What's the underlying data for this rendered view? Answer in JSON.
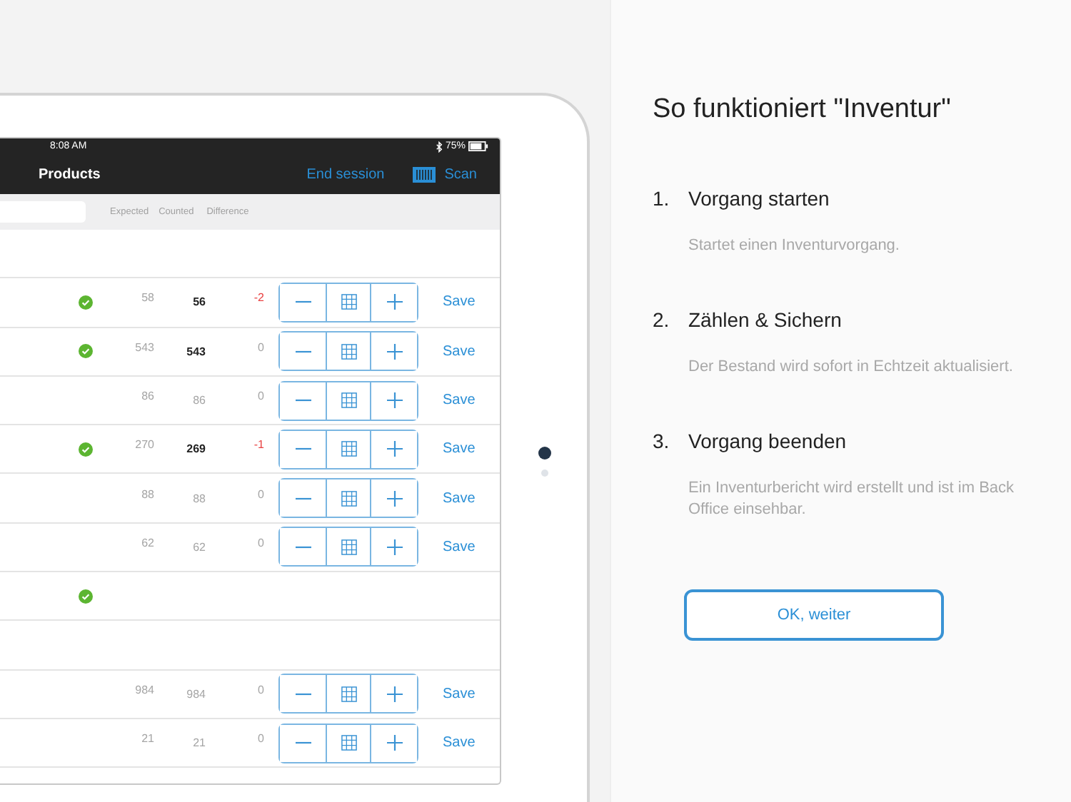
{
  "device": {
    "status_bar": {
      "time": "8:08 AM",
      "battery": "75%"
    },
    "nav_bar": {
      "title": "Products",
      "end_session": "End session",
      "scan": "Scan"
    },
    "table": {
      "columns": [
        "Expected",
        "Counted",
        "Difference"
      ],
      "rows": [
        {
          "kind": "group",
          "confirmed": false
        },
        {
          "kind": "item",
          "confirmed": true,
          "expected": "58",
          "counted": "56",
          "difference": "-2",
          "discrepancy": true,
          "save": "Save"
        },
        {
          "kind": "item",
          "confirmed": true,
          "expected": "543",
          "counted": "543",
          "difference": "0",
          "discrepancy": false,
          "save": "Save"
        },
        {
          "kind": "item",
          "confirmed": false,
          "expected": "86",
          "counted": "86",
          "difference": "0",
          "discrepancy": false,
          "save": "Save"
        },
        {
          "kind": "item",
          "confirmed": true,
          "expected": "270",
          "counted": "269",
          "difference": "-1",
          "discrepancy": true,
          "save": "Save"
        },
        {
          "kind": "item",
          "confirmed": false,
          "expected": "88",
          "counted": "88",
          "difference": "0",
          "discrepancy": false,
          "save": "Save"
        },
        {
          "kind": "item",
          "confirmed": false,
          "expected": "62",
          "counted": "62",
          "difference": "0",
          "discrepancy": false,
          "save": "Save"
        },
        {
          "kind": "group",
          "confirmed": true
        },
        {
          "kind": "group",
          "confirmed": false
        },
        {
          "kind": "item",
          "confirmed": false,
          "expected": "984",
          "counted": "984",
          "difference": "0",
          "discrepancy": false,
          "save": "Save"
        },
        {
          "kind": "item",
          "confirmed": false,
          "expected": "21",
          "counted": "21",
          "difference": "0",
          "discrepancy": false,
          "save": "Save"
        }
      ]
    }
  },
  "page_dots": [
    {
      "selected": true
    },
    {
      "selected": false
    }
  ],
  "guide": {
    "title": "So funktioniert \"Inventur\"",
    "steps": [
      {
        "number": "1.",
        "title": "Vorgang starten",
        "description": "Startet einen Inventurvorgang."
      },
      {
        "number": "2.",
        "title": "Zählen & Sichern",
        "description": "Der Bestand wird sofort in Echtzeit aktualisiert."
      },
      {
        "number": "3.",
        "title": "Vorgang beenden",
        "description": "Ein Inventurbericht wird erstellt und ist im Back Office einsehbar."
      }
    ],
    "button": "OK, weiter"
  }
}
